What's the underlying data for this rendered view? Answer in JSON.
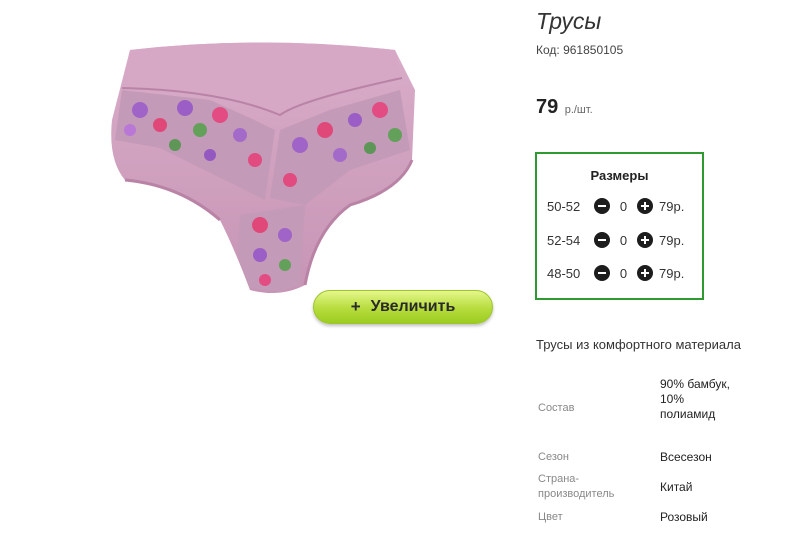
{
  "product": {
    "title": "Трусы",
    "code": "Код: 961850105",
    "price_value": "79",
    "price_unit": "р./шт.",
    "zoom_label": "Увеличить",
    "image_icon": "panties-product-image"
  },
  "sizes": {
    "title": "Размеры",
    "rows": [
      {
        "label": "50-52",
        "qty": "0",
        "price": "79р."
      },
      {
        "label": "52-54",
        "qty": "0",
        "price": "79р."
      },
      {
        "label": "48-50",
        "qty": "0",
        "price": "79р."
      }
    ]
  },
  "description": "Трусы из комфортного материала",
  "specs": [
    {
      "label": "Состав",
      "value": "90% бамбук, 10% полиамид"
    },
    {
      "label": "Сезон",
      "value": "Всесезон"
    },
    {
      "label": "Страна-производитель",
      "value": "Китай"
    },
    {
      "label": "Цвет",
      "value": "Розовый"
    }
  ],
  "colors": {
    "box_border": "#2f9a2f",
    "button_green": "#b6dc3c",
    "fabric_pink": "#d3a6c4"
  }
}
